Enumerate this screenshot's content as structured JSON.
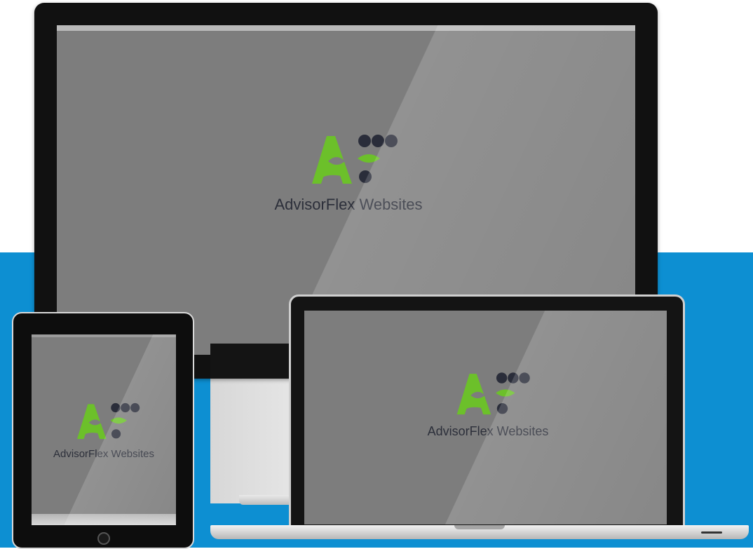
{
  "brand": {
    "name": "AdvisorFlex Websites",
    "colors": {
      "green": "#6cc02a",
      "navy": "#2a2d3a",
      "blue_band": "#0d8fd2",
      "screen_gray": "#7d7d7d"
    }
  },
  "devices": {
    "monitor": {
      "caption": "AdvisorFlex Websites",
      "icon": "advisorflex-logo-icon"
    },
    "laptop": {
      "caption": "AdvisorFlex Websites",
      "icon": "advisorflex-logo-icon"
    },
    "tablet": {
      "caption": "AdvisorFlex Websites",
      "icon": "advisorflex-logo-icon"
    }
  }
}
